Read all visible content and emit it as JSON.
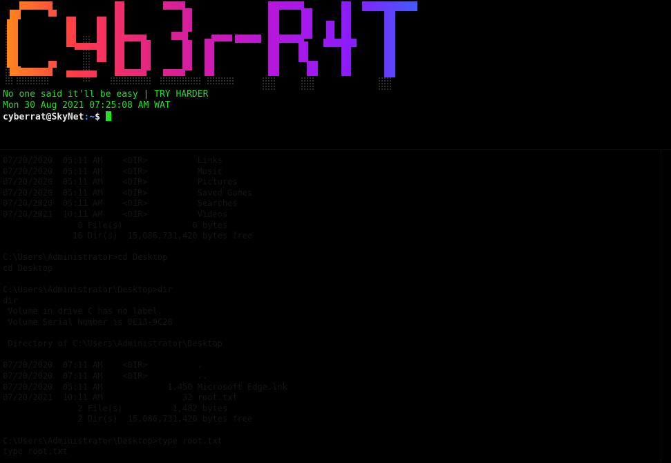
{
  "banner": {
    "text": "Cyb3r-R4T",
    "gradient": [
      "#ff8c1a",
      "#ff3a4a",
      "#d81e9a",
      "#b818d8",
      "#8a1cff",
      "#3566ff"
    ]
  },
  "terminal": {
    "tagline": "No one said it'll be easy | TRY HARDER",
    "datetime": "Mon 30 Aug 2021 07:25:08 AM WAT",
    "prompt": {
      "user_host": "cyberrat@SkyNet",
      "separator": ":",
      "cwd": "~",
      "symbol": "$ "
    }
  },
  "background_output": [
    "07/20/2020  05:11 AM    <DIR>          Links",
    "07/20/2020  05:11 AM    <DIR>          Music",
    "07/20/2020  05:11 AM    <DIR>          Pictures",
    "07/20/2020  05:11 AM    <DIR>          Saved Games",
    "07/20/2020  05:11 AM    <DIR>          Searches",
    "07/20/2021  10:11 AM    <DIR>          Videos",
    "               0 File(s)              0 bytes",
    "              16 Dir(s)  15,086,731,420 bytes free",
    "",
    "C:\\Users\\Administrator>cd Desktop",
    "cd Desktop",
    "",
    "C:\\Users\\Administrator\\Desktop>dir",
    "dir",
    " Volume in drive C has no label.",
    " Volume Serial Number is 0E13-9C28",
    "",
    " Directory of C:\\Users\\Administrator\\Desktop",
    "",
    "07/20/2020  07:11 AM    <DIR>          .",
    "07/20/2020  07:11 AM    <DIR>          ..",
    "07/20/2020  05:11 AM             1,450 Microsoft Edge.lnk",
    "07/20/2021  10:11 AM                32 root.txt",
    "               2 File(s)          1,482 bytes",
    "               2 Dir(s)  15,086,731,420 bytes free",
    "",
    "C:\\Users\\Administrator\\Desktop>type root.txt",
    "type root.txt"
  ]
}
